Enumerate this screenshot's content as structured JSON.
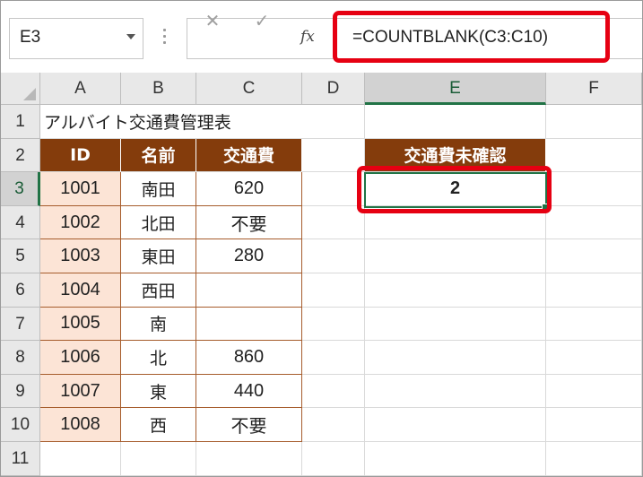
{
  "formula_bar": {
    "name_box": "E3",
    "cancel_icon": "✕",
    "enter_icon": "✓",
    "fx_label": "fx",
    "formula": "=COUNTBLANK(C3:C10)"
  },
  "columns": [
    "A",
    "B",
    "C",
    "D",
    "E",
    "F"
  ],
  "selected_column": "E",
  "rows": [
    "1",
    "2",
    "3",
    "4",
    "5",
    "6",
    "7",
    "8",
    "9",
    "10",
    "11"
  ],
  "selected_row": "3",
  "sheet": {
    "title": "アルバイト交通費管理表",
    "table_headers": [
      "ID",
      "名前",
      "交通費"
    ],
    "table_rows": [
      [
        "1001",
        "南田",
        "620"
      ],
      [
        "1002",
        "北田",
        "不要"
      ],
      [
        "1003",
        "東田",
        "280"
      ],
      [
        "1004",
        "西田",
        ""
      ],
      [
        "1005",
        "南",
        ""
      ],
      [
        "1006",
        "北",
        "860"
      ],
      [
        "1007",
        "東",
        "440"
      ],
      [
        "1008",
        "西",
        "不要"
      ]
    ],
    "summary_header": "交通費未確認",
    "summary_value": "2"
  },
  "colors": {
    "header_fill": "#843c0c",
    "id_fill": "#fce4d6",
    "highlight": "#e60012",
    "selection": "#217346"
  }
}
